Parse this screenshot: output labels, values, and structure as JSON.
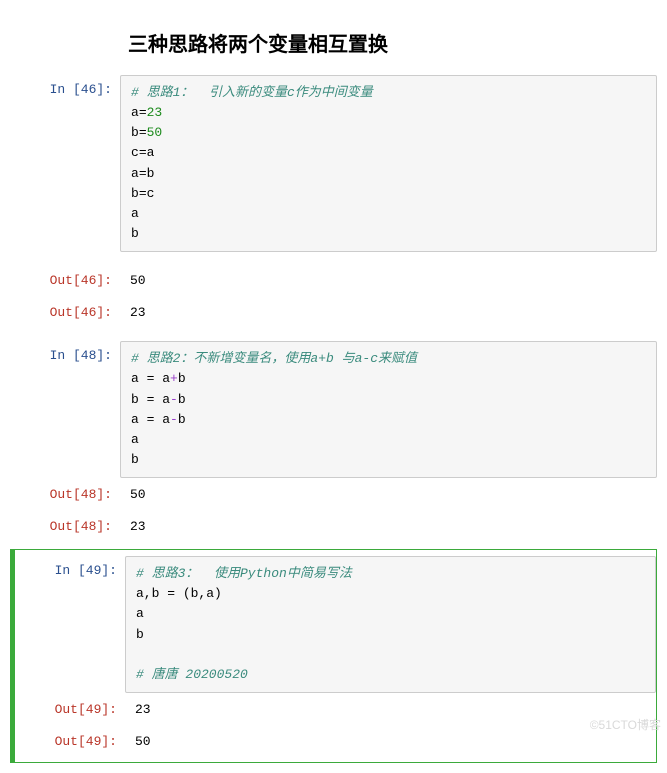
{
  "title": "三种思路将两个变量相互置换",
  "cells": [
    {
      "prompt_in": "In [46]:",
      "code_html": "<span class='comment'># 思路1：  引入新的变量c作为中间变量</span>\na<span class='op-eq'>=</span><span class='num'>23</span>\nb<span class='op-eq'>=</span><span class='num'>50</span>\nc<span class='op-eq'>=</span>a\na<span class='op-eq'>=</span>b\nb<span class='op-eq'>=</span>c\na\nb",
      "outputs": [
        {
          "prompt": "Out[46]:",
          "value": "50"
        },
        {
          "prompt": "Out[46]:",
          "value": "23"
        }
      ]
    },
    {
      "prompt_in": "In [48]:",
      "code_html": "<span class='comment'># 思路2：不新增变量名，使用a+b 与a-c来赋值</span>\na <span class='op-eq'>=</span> a<span class='op-plus'>+</span>b\nb <span class='op-eq'>=</span> a<span class='op-minus'>-</span>b\na <span class='op-eq'>=</span> a<span class='op-minus'>-</span>b\na\nb",
      "outputs": [
        {
          "prompt": "Out[48]:",
          "value": "50"
        },
        {
          "prompt": "Out[48]:",
          "value": "23"
        }
      ]
    },
    {
      "prompt_in": "In [49]:",
      "selected": true,
      "code_html": "<span class='comment'># 思路3：  使用Python中简易写法</span>\na,b <span class='op-eq'>=</span> (b,a)\na\nb\n\n<span class='comment'># 唐唐 20200520</span>",
      "outputs": [
        {
          "prompt": "Out[49]:",
          "value": "23"
        },
        {
          "prompt": "Out[49]:",
          "value": "50"
        }
      ]
    }
  ],
  "watermark": "©51CTO博客"
}
